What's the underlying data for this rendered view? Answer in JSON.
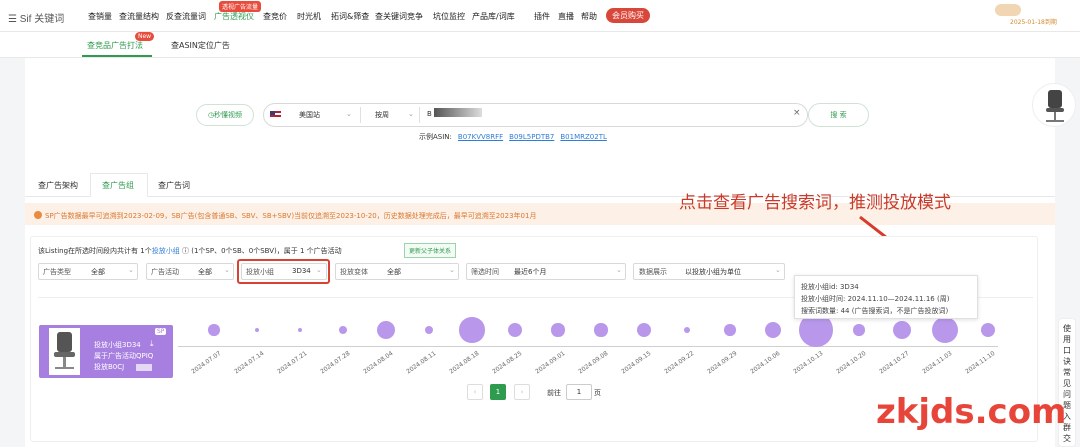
{
  "brand": {
    "logo": "Sif 关键词"
  },
  "nav": {
    "items": [
      "查销量",
      "查流量结构",
      "反查流量词",
      "广告透视仪",
      "查竞价",
      "时光机",
      "拓词&筛查",
      "查关键词竞争",
      "坑位监控",
      "产品库/词库",
      "插件",
      "直播",
      "帮助"
    ],
    "active_badge": "透视广告流量",
    "vip": "会员购买",
    "expire": "2025-01-18到期"
  },
  "subnav": {
    "tab1": "查竞品广告打法",
    "tab1_badge": "New",
    "tab2": "查ASIN定位广告"
  },
  "search": {
    "video_btn": "秒懂视频",
    "site": "美国站",
    "period": "按周",
    "query_prefix": "B",
    "clear": "×",
    "button": "搜 索",
    "example_label": "示例ASIN:",
    "examples": [
      "B07KVV8RFF",
      "B09L5PDTB7",
      "B01MRZ02TL"
    ]
  },
  "tabs": [
    "查广告架构",
    "查广告组",
    "查广告词"
  ],
  "notice": "SP广告数据最早可追溯到2023-02-09，SB广告(包含普通SB、SBV、SB+SBV)当前仅追溯至2023-10-20，历史数据处理完成后，最早可追溯至2023年01月",
  "annotation": "点击查看广告搜索词，推测投放模式",
  "summary": {
    "pre": "该Listing在所选时间段内共计有 ",
    "count": "1",
    "mid": "个",
    "link": "投放小组",
    "post": " (1个SP、0个SB、0个SBV)，属于 1 个广告活动",
    "parent_btn": "更新父子体关系"
  },
  "filters": [
    {
      "label": "广告类型",
      "value": "全部"
    },
    {
      "label": "广告活动",
      "value": "全部"
    },
    {
      "label": "投放小组",
      "value": "3D34"
    },
    {
      "label": "投放变体",
      "value": "全部"
    },
    {
      "label": "筛选时间",
      "value": "最近6个月"
    },
    {
      "label": "数据展示",
      "value": "以投放小组为单位"
    }
  ],
  "group": {
    "sp": "SP",
    "line1": "投放小组3D34",
    "line2": "属于广告活动QPIQ",
    "line3": "投放B0CJ"
  },
  "chart_data": {
    "type": "scatter",
    "x": [
      "2024.07.07",
      "2024.07.14",
      "2024.07.21",
      "2024.07.28",
      "2024.08.04",
      "2024.08.11",
      "2024.08.18",
      "2024.08.25",
      "2024.09.01",
      "2024.09.08",
      "2024.09.15",
      "2024.09.22",
      "2024.09.29",
      "2024.10.06",
      "2024.10.13",
      "2024.10.20",
      "2024.10.27",
      "2024.11.03",
      "2024.11.10"
    ],
    "y": [
      "3D34",
      "3D34",
      "3D34",
      "3D34",
      "3D34",
      "3D34",
      "3D34",
      "3D34",
      "3D34",
      "3D34",
      "3D34",
      "3D34",
      "3D34",
      "3D34",
      "3D34",
      "3D34",
      "3D34",
      "3D34",
      "3D34"
    ],
    "sizes": [
      5,
      1,
      1,
      3,
      9,
      3,
      13,
      7,
      6,
      6,
      7,
      2,
      5,
      8,
      18,
      5,
      9,
      14,
      7
    ],
    "sizes_note": "",
    "legend": "none",
    "grid": false
  },
  "tooltip": {
    "line1": "投放小组id: 3D34",
    "line2": "投放小组时间: 2024.11.10—2024.11.16 (周)",
    "line3": "搜索词数量: 44 (广告搜索词，不是广告投放词)"
  },
  "pager": {
    "prev": "‹",
    "current": "1",
    "next": "›",
    "goto_label": "前往",
    "goto_value": "1",
    "page_suffix": "页"
  },
  "side_help": [
    "使",
    "用",
    "口",
    "诀",
    "常",
    "见",
    "问",
    "题",
    "入",
    "群",
    "交"
  ],
  "watermark": "zkjds.com"
}
